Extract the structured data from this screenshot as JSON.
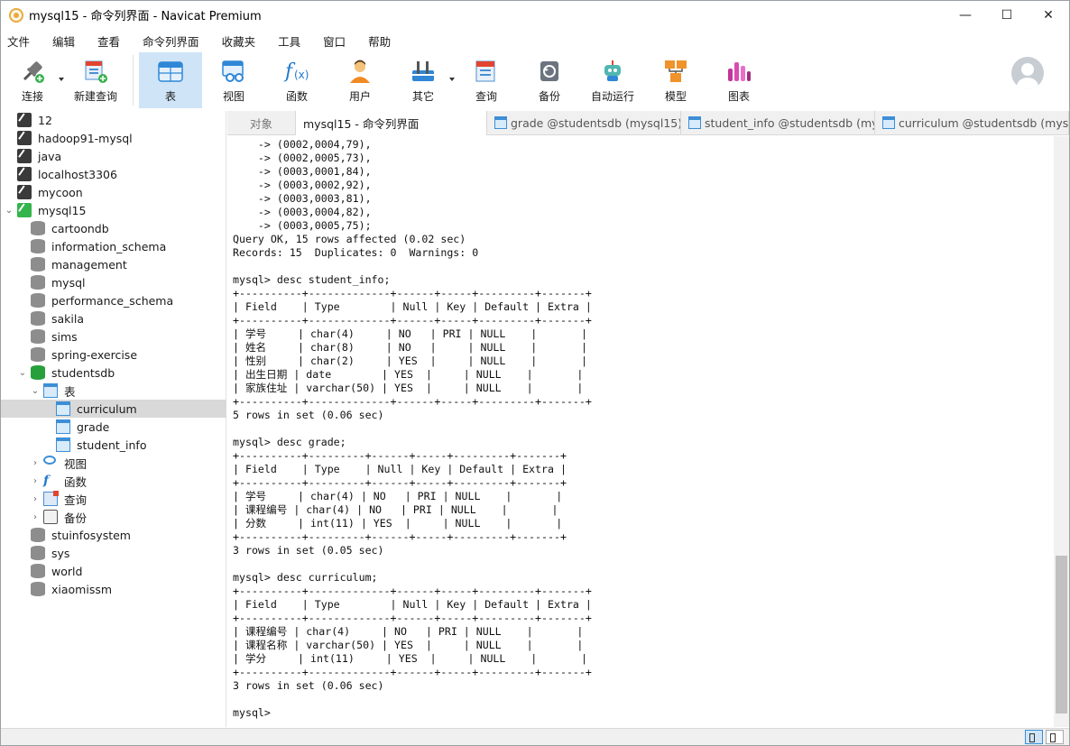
{
  "titlebar": {
    "title": "mysql15 - 命令列界面 - Navicat Premium",
    "minimize": "—",
    "maximize": "☐",
    "close": "✕"
  },
  "menu": [
    "文件",
    "编辑",
    "查看",
    "命令列界面",
    "收藏夹",
    "工具",
    "窗口",
    "帮助"
  ],
  "toolbar": [
    {
      "label": "连接",
      "icon": "connection-icon",
      "caret": true
    },
    {
      "label": "新建查询",
      "icon": "new-query-icon",
      "caret": false
    },
    {
      "label": "表",
      "icon": "table-icon",
      "caret": false,
      "active": true
    },
    {
      "label": "视图",
      "icon": "view-icon",
      "caret": false
    },
    {
      "label": "函数",
      "icon": "function-icon",
      "caret": false
    },
    {
      "label": "用户",
      "icon": "user-icon",
      "caret": false
    },
    {
      "label": "其它",
      "icon": "tools-icon",
      "caret": true
    },
    {
      "label": "查询",
      "icon": "query-icon",
      "caret": false
    },
    {
      "label": "备份",
      "icon": "backup-icon",
      "caret": false
    },
    {
      "label": "自动运行",
      "icon": "robot-icon",
      "caret": false
    },
    {
      "label": "模型",
      "icon": "model-icon",
      "caret": false
    },
    {
      "label": "图表",
      "icon": "chart-icon",
      "caret": false
    }
  ],
  "tree": [
    {
      "label": "12",
      "icon": "conn",
      "level": 0
    },
    {
      "label": "hadoop91-mysql",
      "icon": "conn",
      "level": 0
    },
    {
      "label": "java",
      "icon": "conn",
      "level": 0
    },
    {
      "label": "localhost3306",
      "icon": "conn",
      "level": 0
    },
    {
      "label": "mycoon",
      "icon": "conn",
      "level": 0
    },
    {
      "label": "mysql15",
      "icon": "conn-green",
      "level": 0,
      "arrow": "down"
    },
    {
      "label": "cartoondb",
      "icon": "db",
      "level": 1
    },
    {
      "label": "information_schema",
      "icon": "db",
      "level": 1
    },
    {
      "label": "management",
      "icon": "db",
      "level": 1
    },
    {
      "label": "mysql",
      "icon": "db",
      "level": 1
    },
    {
      "label": "performance_schema",
      "icon": "db",
      "level": 1
    },
    {
      "label": "sakila",
      "icon": "db",
      "level": 1
    },
    {
      "label": "sims",
      "icon": "db",
      "level": 1
    },
    {
      "label": "spring-exercise",
      "icon": "db",
      "level": 1
    },
    {
      "label": "studentsdb",
      "icon": "db-green",
      "level": 1,
      "arrow": "down"
    },
    {
      "label": "表",
      "icon": "table",
      "level": 2,
      "arrow": "down"
    },
    {
      "label": "curriculum",
      "icon": "table",
      "level": 3,
      "selected": true
    },
    {
      "label": "grade",
      "icon": "table",
      "level": 3
    },
    {
      "label": "student_info",
      "icon": "table",
      "level": 3
    },
    {
      "label": "视图",
      "icon": "view",
      "level": 2,
      "arrow": "right"
    },
    {
      "label": "函数",
      "icon": "func",
      "level": 2,
      "arrow": "right"
    },
    {
      "label": "查询",
      "icon": "query",
      "level": 2,
      "arrow": "right"
    },
    {
      "label": "备份",
      "icon": "backup",
      "level": 2,
      "arrow": "right"
    },
    {
      "label": "stuinfosystem",
      "icon": "db",
      "level": 1
    },
    {
      "label": "sys",
      "icon": "db",
      "level": 1
    },
    {
      "label": "world",
      "icon": "db",
      "level": 1
    },
    {
      "label": "xiaomissm",
      "icon": "db",
      "level": 1
    }
  ],
  "tabs": [
    {
      "label": "对象",
      "type": "objects"
    },
    {
      "label": "mysql15 - 命令列界面",
      "type": "console",
      "active": true
    },
    {
      "label": "grade @studentsdb (mysql15)...",
      "type": "table"
    },
    {
      "label": "student_info @studentsdb (my...",
      "type": "table"
    },
    {
      "label": "curriculum @studentsdb (mys...",
      "type": "table"
    }
  ],
  "console_lines": [
    "    -> (0002,0004,79),",
    "    -> (0002,0005,73),",
    "    -> (0003,0001,84),",
    "    -> (0003,0002,92),",
    "    -> (0003,0003,81),",
    "    -> (0003,0004,82),",
    "    -> (0003,0005,75);",
    "Query OK, 15 rows affected (0.02 sec)",
    "Records: 15  Duplicates: 0  Warnings: 0",
    "",
    "mysql> desc student_info;",
    "+----------+-------------+------+-----+---------+-------+",
    "| Field    | Type        | Null | Key | Default | Extra |",
    "+----------+-------------+------+-----+---------+-------+",
    "| 学号     | char(4)     | NO   | PRI | NULL    |       |",
    "| 姓名     | char(8)     | NO   |     | NULL    |       |",
    "| 性别     | char(2)     | YES  |     | NULL    |       |",
    "| 出生日期 | date        | YES  |     | NULL    |       |",
    "| 家族住址 | varchar(50) | YES  |     | NULL    |       |",
    "+----------+-------------+------+-----+---------+-------+",
    "5 rows in set (0.06 sec)",
    "",
    "mysql> desc grade;",
    "+----------+---------+------+-----+---------+-------+",
    "| Field    | Type    | Null | Key | Default | Extra |",
    "+----------+---------+------+-----+---------+-------+",
    "| 学号     | char(4) | NO   | PRI | NULL    |       |",
    "| 课程编号 | char(4) | NO   | PRI | NULL    |       |",
    "| 分数     | int(11) | YES  |     | NULL    |       |",
    "+----------+---------+------+-----+---------+-------+",
    "3 rows in set (0.05 sec)",
    "",
    "mysql> desc curriculum;",
    "+----------+-------------+------+-----+---------+-------+",
    "| Field    | Type        | Null | Key | Default | Extra |",
    "+----------+-------------+------+-----+---------+-------+",
    "| 课程编号 | char(4)     | NO   | PRI | NULL    |       |",
    "| 课程名称 | varchar(50) | YES  |     | NULL    |       |",
    "| 学分     | int(11)     | YES  |     | NULL    |       |",
    "+----------+-------------+------+-----+---------+-------+",
    "3 rows in set (0.06 sec)",
    "",
    "mysql>"
  ]
}
